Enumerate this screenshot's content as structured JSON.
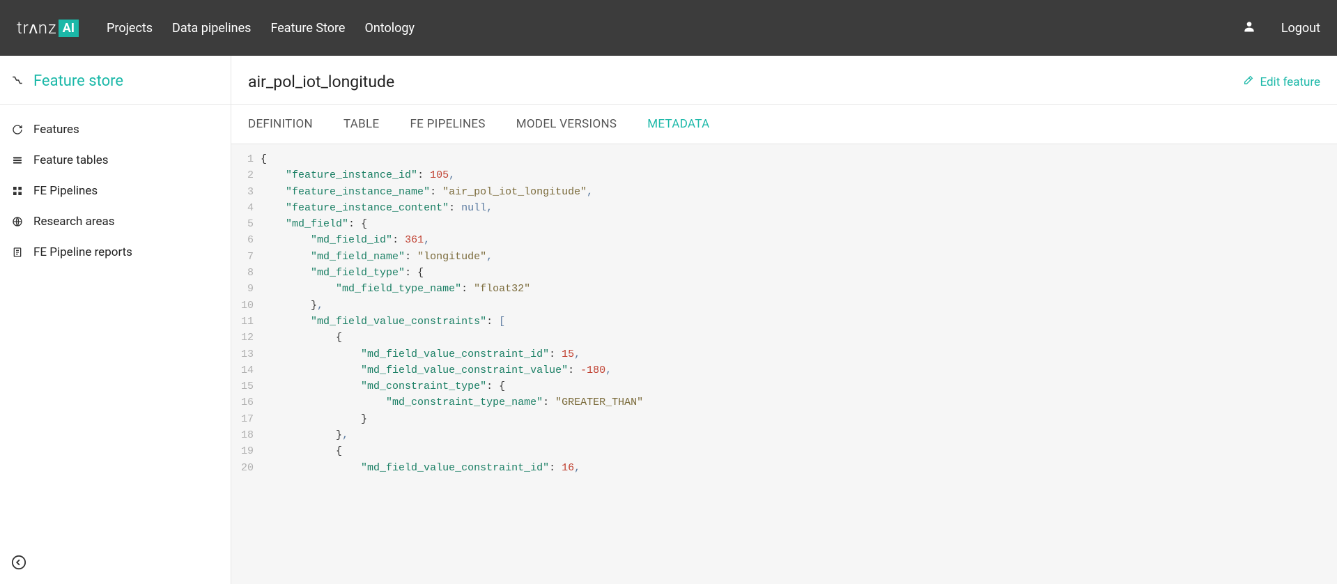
{
  "header": {
    "brand_text": "trᴧnz",
    "brand_box": "AI",
    "nav": [
      "Projects",
      "Data pipelines",
      "Feature Store",
      "Ontology"
    ],
    "logout": "Logout"
  },
  "sidebar": {
    "title": "Feature store",
    "items": [
      {
        "icon": "refresh",
        "label": "Features"
      },
      {
        "icon": "layers",
        "label": "Feature tables"
      },
      {
        "icon": "grid",
        "label": "FE Pipelines"
      },
      {
        "icon": "globe",
        "label": "Research areas"
      },
      {
        "icon": "doc",
        "label": "FE Pipeline reports"
      }
    ]
  },
  "content": {
    "title": "air_pol_iot_longitude",
    "edit_label": "Edit feature",
    "tabs": [
      "DEFINITION",
      "TABLE",
      "FE PIPELINES",
      "MODEL VERSIONS",
      "METADATA"
    ],
    "active_tab": 4
  },
  "code_lines": [
    [
      {
        "t": "brace",
        "v": "{"
      }
    ],
    [
      {
        "t": "ind",
        "v": "    "
      },
      {
        "t": "key",
        "v": "\"feature_instance_id\""
      },
      {
        "t": "colon",
        "v": ": "
      },
      {
        "t": "num",
        "v": "105"
      },
      {
        "t": "punc",
        "v": ","
      }
    ],
    [
      {
        "t": "ind",
        "v": "    "
      },
      {
        "t": "key",
        "v": "\"feature_instance_name\""
      },
      {
        "t": "colon",
        "v": ": "
      },
      {
        "t": "str",
        "v": "\"air_pol_iot_longitude\""
      },
      {
        "t": "punc",
        "v": ","
      }
    ],
    [
      {
        "t": "ind",
        "v": "    "
      },
      {
        "t": "key",
        "v": "\"feature_instance_content\""
      },
      {
        "t": "colon",
        "v": ": "
      },
      {
        "t": "null",
        "v": "null"
      },
      {
        "t": "punc",
        "v": ","
      }
    ],
    [
      {
        "t": "ind",
        "v": "    "
      },
      {
        "t": "key",
        "v": "\"md_field\""
      },
      {
        "t": "colon",
        "v": ": "
      },
      {
        "t": "brace",
        "v": "{"
      }
    ],
    [
      {
        "t": "ind",
        "v": "        "
      },
      {
        "t": "key",
        "v": "\"md_field_id\""
      },
      {
        "t": "colon",
        "v": ": "
      },
      {
        "t": "num",
        "v": "361"
      },
      {
        "t": "punc",
        "v": ","
      }
    ],
    [
      {
        "t": "ind",
        "v": "        "
      },
      {
        "t": "key",
        "v": "\"md_field_name\""
      },
      {
        "t": "colon",
        "v": ": "
      },
      {
        "t": "str",
        "v": "\"longitude\""
      },
      {
        "t": "punc",
        "v": ","
      }
    ],
    [
      {
        "t": "ind",
        "v": "        "
      },
      {
        "t": "key",
        "v": "\"md_field_type\""
      },
      {
        "t": "colon",
        "v": ": "
      },
      {
        "t": "brace",
        "v": "{"
      }
    ],
    [
      {
        "t": "ind",
        "v": "            "
      },
      {
        "t": "key",
        "v": "\"md_field_type_name\""
      },
      {
        "t": "colon",
        "v": ": "
      },
      {
        "t": "str",
        "v": "\"float32\""
      }
    ],
    [
      {
        "t": "ind",
        "v": "        "
      },
      {
        "t": "brace",
        "v": "}"
      },
      {
        "t": "punc",
        "v": ","
      }
    ],
    [
      {
        "t": "ind",
        "v": "        "
      },
      {
        "t": "key",
        "v": "\"md_field_value_constraints\""
      },
      {
        "t": "colon",
        "v": ": "
      },
      {
        "t": "punc",
        "v": "["
      }
    ],
    [
      {
        "t": "ind",
        "v": "            "
      },
      {
        "t": "brace",
        "v": "{"
      }
    ],
    [
      {
        "t": "ind",
        "v": "                "
      },
      {
        "t": "key",
        "v": "\"md_field_value_constraint_id\""
      },
      {
        "t": "colon",
        "v": ": "
      },
      {
        "t": "num",
        "v": "15"
      },
      {
        "t": "punc",
        "v": ","
      }
    ],
    [
      {
        "t": "ind",
        "v": "                "
      },
      {
        "t": "key",
        "v": "\"md_field_value_constraint_value\""
      },
      {
        "t": "colon",
        "v": ": "
      },
      {
        "t": "num",
        "v": "-180"
      },
      {
        "t": "punc",
        "v": ","
      }
    ],
    [
      {
        "t": "ind",
        "v": "                "
      },
      {
        "t": "key",
        "v": "\"md_constraint_type\""
      },
      {
        "t": "colon",
        "v": ": "
      },
      {
        "t": "brace",
        "v": "{"
      }
    ],
    [
      {
        "t": "ind",
        "v": "                    "
      },
      {
        "t": "key",
        "v": "\"md_constraint_type_name\""
      },
      {
        "t": "colon",
        "v": ": "
      },
      {
        "t": "str",
        "v": "\"GREATER_THAN\""
      }
    ],
    [
      {
        "t": "ind",
        "v": "                "
      },
      {
        "t": "brace",
        "v": "}"
      }
    ],
    [
      {
        "t": "ind",
        "v": "            "
      },
      {
        "t": "brace",
        "v": "}"
      },
      {
        "t": "punc",
        "v": ","
      }
    ],
    [
      {
        "t": "ind",
        "v": "            "
      },
      {
        "t": "brace",
        "v": "{"
      }
    ],
    [
      {
        "t": "ind",
        "v": "                "
      },
      {
        "t": "key",
        "v": "\"md_field_value_constraint_id\""
      },
      {
        "t": "colon",
        "v": ": "
      },
      {
        "t": "num",
        "v": "16"
      },
      {
        "t": "punc",
        "v": ","
      }
    ]
  ]
}
